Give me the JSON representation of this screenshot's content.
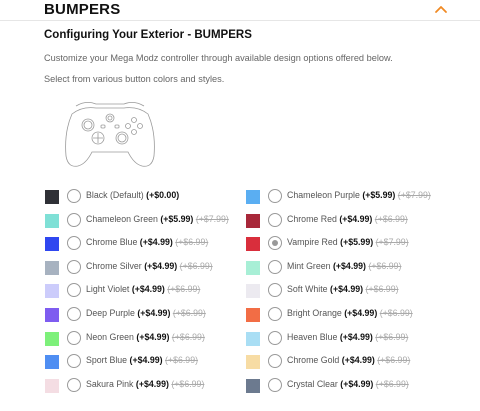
{
  "header": {
    "title": "BUMPERS",
    "toggle_icon": "chevron-up-icon",
    "accent": "#f08a24"
  },
  "config": {
    "title": "Configuring Your Exterior - BUMPERS",
    "desc1": "Customize your Mega Modz controller through available design options offered below.",
    "desc2": "Select from various button colors and styles."
  },
  "options": [
    {
      "name": "Black (Default)",
      "price": "(+$0.00)",
      "old": "",
      "color": "#2f3036",
      "selected": false
    },
    {
      "name": "Chameleon Green",
      "price": "(+$5.99)",
      "old": "(+$7.99)",
      "color": "#7fe0d6",
      "selected": false
    },
    {
      "name": "Chrome Blue",
      "price": "(+$4.99)",
      "old": "(+$6.99)",
      "color": "#2f47f0",
      "selected": false
    },
    {
      "name": "Chrome Silver",
      "price": "(+$4.99)",
      "old": "(+$6.99)",
      "color": "#a7b2c0",
      "selected": false
    },
    {
      "name": "Light Violet",
      "price": "(+$4.99)",
      "old": "(+$6.99)",
      "color": "#ccccfb",
      "selected": false
    },
    {
      "name": "Deep Purple",
      "price": "(+$4.99)",
      "old": "(+$6.99)",
      "color": "#7e5cf0",
      "selected": false
    },
    {
      "name": "Neon Green",
      "price": "(+$4.99)",
      "old": "(+$6.99)",
      "color": "#7df07a",
      "selected": false
    },
    {
      "name": "Sport Blue",
      "price": "(+$4.99)",
      "old": "(+$6.99)",
      "color": "#4f8ef2",
      "selected": false
    },
    {
      "name": "Sakura Pink",
      "price": "(+$4.99)",
      "old": "(+$6.99)",
      "color": "#f4dde3",
      "selected": false
    },
    {
      "name": "Chameleon Purple",
      "price": "(+$5.99)",
      "old": "(+$7.99)",
      "color": "#5aaef2",
      "selected": false
    },
    {
      "name": "Chrome Red",
      "price": "(+$4.99)",
      "old": "(+$6.99)",
      "color": "#a8283a",
      "selected": false
    },
    {
      "name": "Vampire Red",
      "price": "(+$5.99)",
      "old": "(+$7.99)",
      "color": "#d92e3c",
      "selected": true
    },
    {
      "name": "Mint Green",
      "price": "(+$4.99)",
      "old": "(+$6.99)",
      "color": "#a8efd6",
      "selected": false
    },
    {
      "name": "Soft White",
      "price": "(+$4.99)",
      "old": "(+$6.99)",
      "color": "#eceaf0",
      "selected": false
    },
    {
      "name": "Bright Orange",
      "price": "(+$4.99)",
      "old": "(+$6.99)",
      "color": "#f26d45",
      "selected": false
    },
    {
      "name": "Heaven Blue",
      "price": "(+$4.99)",
      "old": "(+$6.99)",
      "color": "#a9def4",
      "selected": false
    },
    {
      "name": "Chrome Gold",
      "price": "(+$4.99)",
      "old": "(+$6.99)",
      "color": "#f7dca4",
      "selected": false
    },
    {
      "name": "Crystal Clear",
      "price": "(+$4.99)",
      "old": "(+$6.99)",
      "color": "#6c7a8f",
      "selected": false
    }
  ]
}
